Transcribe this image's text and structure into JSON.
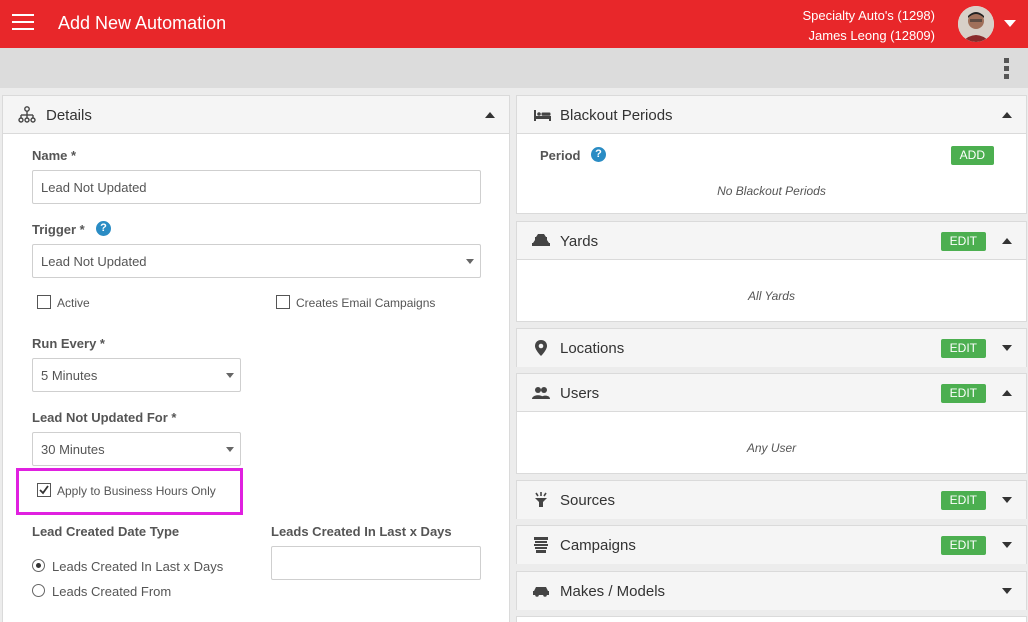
{
  "header": {
    "title": "Add New Automation",
    "dealer": "Specialty Auto's (1298)",
    "user": "James Leong (12809)"
  },
  "details": {
    "title": "Details",
    "name_label": "Name *",
    "name_value": "Lead Not Updated",
    "trigger_label": "Trigger *",
    "trigger_value": "Lead Not Updated",
    "help": "?",
    "active_label": "Active",
    "active_checked": false,
    "email_campaigns_label": "Creates Email Campaigns",
    "email_campaigns_checked": false,
    "run_every_label": "Run Every *",
    "run_every_value": "5 Minutes",
    "not_updated_label": "Lead Not Updated For *",
    "not_updated_value": "30 Minutes",
    "business_hours_label": "Apply to Business Hours Only",
    "business_hours_checked": true,
    "highlight_color": "#e020e0",
    "created_type_label": "Lead Created Date Type",
    "radio_last_days": "Leads Created In Last x Days",
    "radio_from": "Leads Created From",
    "selected_radio": "Leads Created In Last x Days",
    "last_days_label": "Leads Created In Last x Days",
    "last_days_value": ""
  },
  "right_panels": {
    "blackout": {
      "title": "Blackout Periods",
      "period_label": "Period",
      "add": "ADD",
      "empty": "No Blackout Periods"
    },
    "yards": {
      "title": "Yards",
      "edit": "EDIT",
      "empty": "All Yards"
    },
    "locations": {
      "title": "Locations",
      "edit": "EDIT"
    },
    "users": {
      "title": "Users",
      "edit": "EDIT",
      "empty": "Any User"
    },
    "sources": {
      "title": "Sources",
      "edit": "EDIT"
    },
    "campaigns": {
      "title": "Campaigns",
      "edit": "EDIT"
    },
    "makes": {
      "title": "Makes / Models"
    }
  },
  "colors": {
    "brand": "#e8272a",
    "edit_green": "#4caf50",
    "help_blue": "#2a8cc4"
  }
}
